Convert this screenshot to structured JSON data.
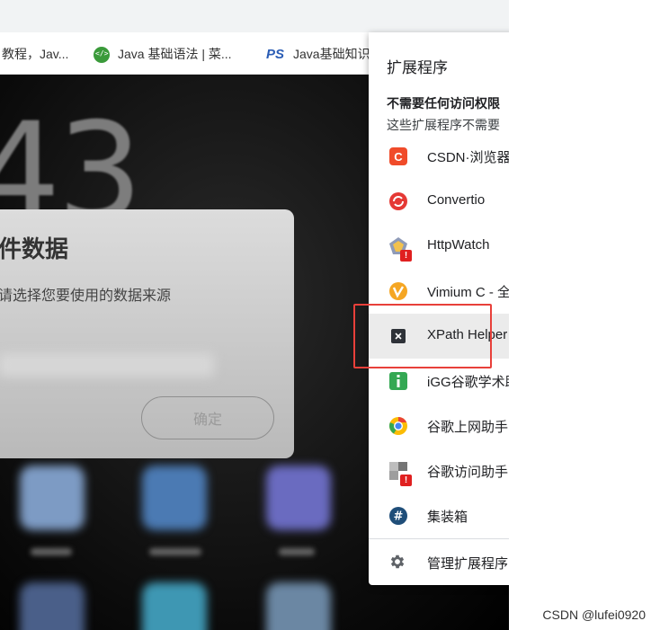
{
  "bookmarks": [
    {
      "label": "教程，Jav..."
    },
    {
      "label": "Java 基础语法 | 菜..."
    },
    {
      "label": "Java基础知识",
      "icon_text": "PS"
    }
  ],
  "background": {
    "clock_text": "43"
  },
  "dialog": {
    "title": "件数据",
    "subtitle": "请选择您要使用的数据来源",
    "confirm_label": "确定"
  },
  "extensions_popup": {
    "title": "扩展程序",
    "heading": "不需要任何访问权限",
    "description": "这些扩展程序不需要",
    "items": [
      {
        "label": "CSDN·浏览器",
        "icon": "csdn-icon",
        "color": "#f04b2a"
      },
      {
        "label": "Convertio",
        "icon": "convertio-icon",
        "color": "#e53935"
      },
      {
        "label": "HttpWatch",
        "icon": "httpwatch-icon",
        "color": "#6f7fa0",
        "warning": "!"
      },
      {
        "label": "Vimium C - 全",
        "icon": "vimium-icon",
        "color": "#f5a623"
      },
      {
        "label": "XPath Helper",
        "icon": "xpath-helper-icon",
        "color": "#2e3238"
      },
      {
        "label": "iGG谷歌学术助",
        "icon": "igg-icon",
        "color": "#34a853"
      },
      {
        "label": "谷歌上网助手",
        "icon": "chrome-helper-icon",
        "color": "#fbbc05"
      },
      {
        "label": "谷歌访问助手",
        "icon": "google-access-icon",
        "color": "#9e9e9e",
        "warning": "!"
      },
      {
        "label": "集装箱",
        "icon": "hashtag-icon",
        "color": "#1f4e79"
      }
    ],
    "manage_label": "管理扩展程序",
    "manage_icon": "gear-icon"
  },
  "watermark": "CSDN @lufei0920"
}
